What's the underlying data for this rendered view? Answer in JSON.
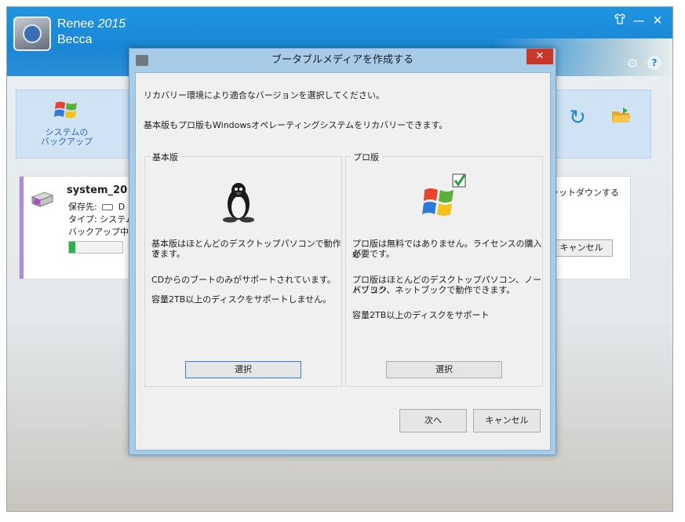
{
  "app": {
    "name": "Renee",
    "year": "2015",
    "user": "Becca",
    "controls": {
      "shirt_icon": "shirt-icon",
      "minimize": "—",
      "close": "✕"
    }
  },
  "toolbar": {
    "system_backup_line1": "システムの",
    "system_backup_line2": "バックアップ"
  },
  "task": {
    "name": "system_20",
    "save_to": "保存先:",
    "save_to_value": "D",
    "type": "タイプ: システム",
    "status": "バックアップ中",
    "progress": 0.12,
    "shutdown_text": "ャットダウンする",
    "cancel": "キャンセル"
  },
  "dialog": {
    "title": "ブータブルメディアを作成する",
    "close": "✕",
    "intro1": "リカバリー環境により適合なバージョンを選択してください。",
    "intro2": "基本版もプロ版もWindowsオペレーティングシステムをリカバリーできます。",
    "basic": {
      "label": "基本版",
      "desc1": "基本版はほとんどのデスクトップパソコンで動作で",
      "desc1b": "きます。",
      "desc2": "CDからのブートのみがサポートされています。",
      "desc3": "容量2TB以上のディスクをサポートしません。",
      "select": "選択"
    },
    "pro": {
      "label": "プロ版",
      "desc1": "プロ版は無料ではありません。ライセンスの購入が",
      "desc1b": "必要です。",
      "desc2": "プロ版はほとんどのデスクトップパソコン、ノートブック",
      "desc2b": "パソコン、ネットブックで動作できます。",
      "desc3": "容量2TB以上のディスクをサポート",
      "select": "選択"
    },
    "next": "次へ",
    "cancel": "キャンセル"
  },
  "colors": {
    "header_blue": "#1a86d6",
    "close_red": "#c7382b",
    "progress_green": "#2bb24a",
    "task_accent": "#b08ad8"
  }
}
